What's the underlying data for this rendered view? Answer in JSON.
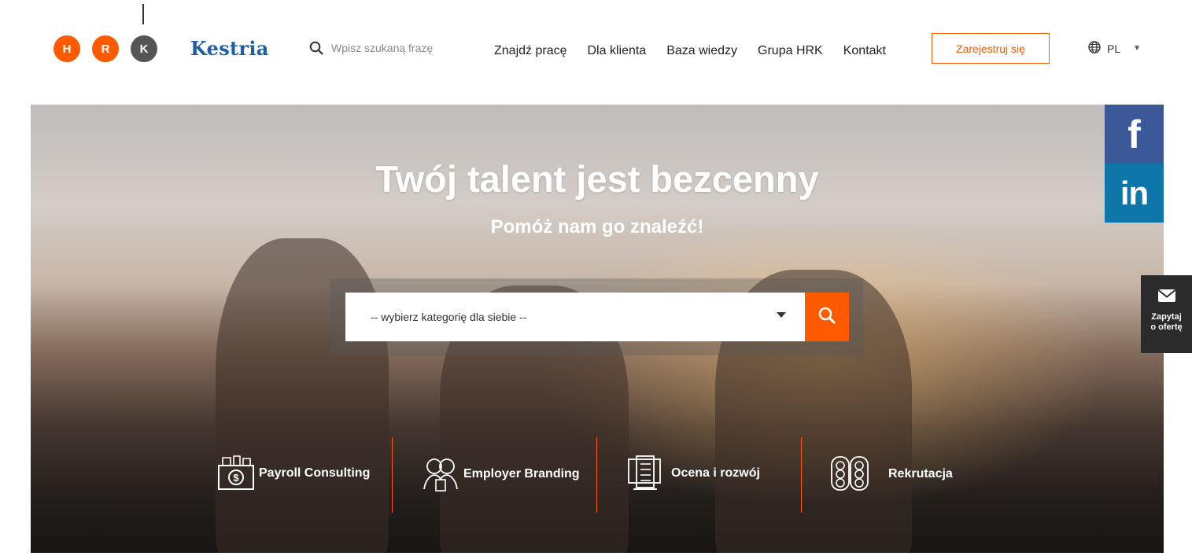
{
  "header": {
    "logo_letters": [
      "H",
      "R",
      "K"
    ],
    "logo_colors": [
      "#ff5a00",
      "#ff5a00",
      "#555555"
    ],
    "brand": "Kestria",
    "search_placeholder": "Wpisz szukaną frazę",
    "search_icon": "search-icon",
    "nav": [
      "Znajdź pracę",
      "Dla klienta",
      "Baza wiedzy",
      "Grupa HRK",
      "Kontakt"
    ],
    "register_label": "Zarejestruj się",
    "language": "PL",
    "language_icon": "globe-icon"
  },
  "hero": {
    "title": "Twój talent jest bezcenny",
    "subtitle": "Pomóż nam go znaleźć!",
    "category_select": "-- wybierz kategorię dla siebie --",
    "services": [
      {
        "label": "Payroll Consulting",
        "icon": "payroll-icon"
      },
      {
        "label": "Employer Branding",
        "icon": "employer-branding-icon"
      },
      {
        "label": "Ocena i rozwój",
        "icon": "assessment-icon"
      },
      {
        "label": "Rekrutacja",
        "icon": "recruitment-icon"
      }
    ]
  },
  "side": {
    "facebook": "f",
    "linkedin": "in",
    "contact_line1": "Zapytaj",
    "contact_line2": "o ofertę",
    "contact_icon": "mail-icon"
  },
  "colors": {
    "accent": "#ff5a00",
    "brand": "#1f5fa8",
    "facebook": "#3b5998",
    "linkedin": "#0e76a8",
    "contact_tab": "#2b2b2b"
  }
}
